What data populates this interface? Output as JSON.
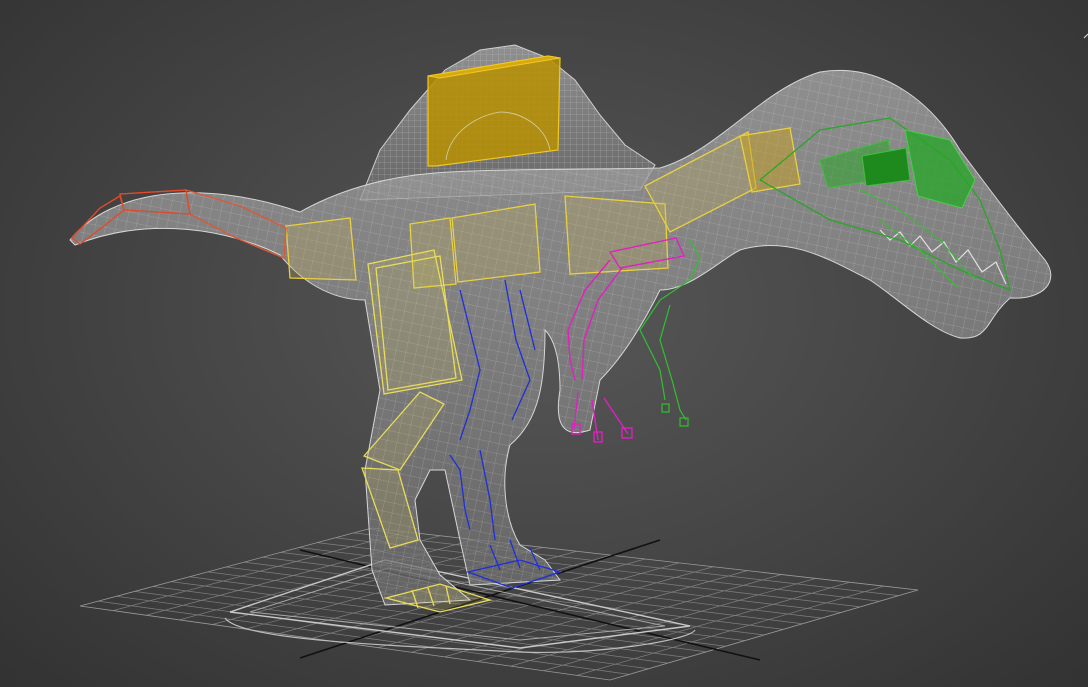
{
  "viewport": {
    "background_center": "#575757",
    "background_edge": "#323232"
  },
  "colors": {
    "mesh_fill": "#8a8a8a",
    "mesh_wire": "#c8c8c8",
    "grid": "#9a9a9a",
    "grid_axis": "#111111",
    "sail_box": "#b89000",
    "spine_boxes": "#e8d040",
    "left_leg": "#e8dc5a",
    "right_leg": "#1f2fd8",
    "left_arm": "#e020c0",
    "right_arm": "#30c030",
    "head": "#2aa52a",
    "tail_tip": "#e04a2a"
  },
  "icons": {
    "model": "spinosaurus-rig-icon"
  }
}
